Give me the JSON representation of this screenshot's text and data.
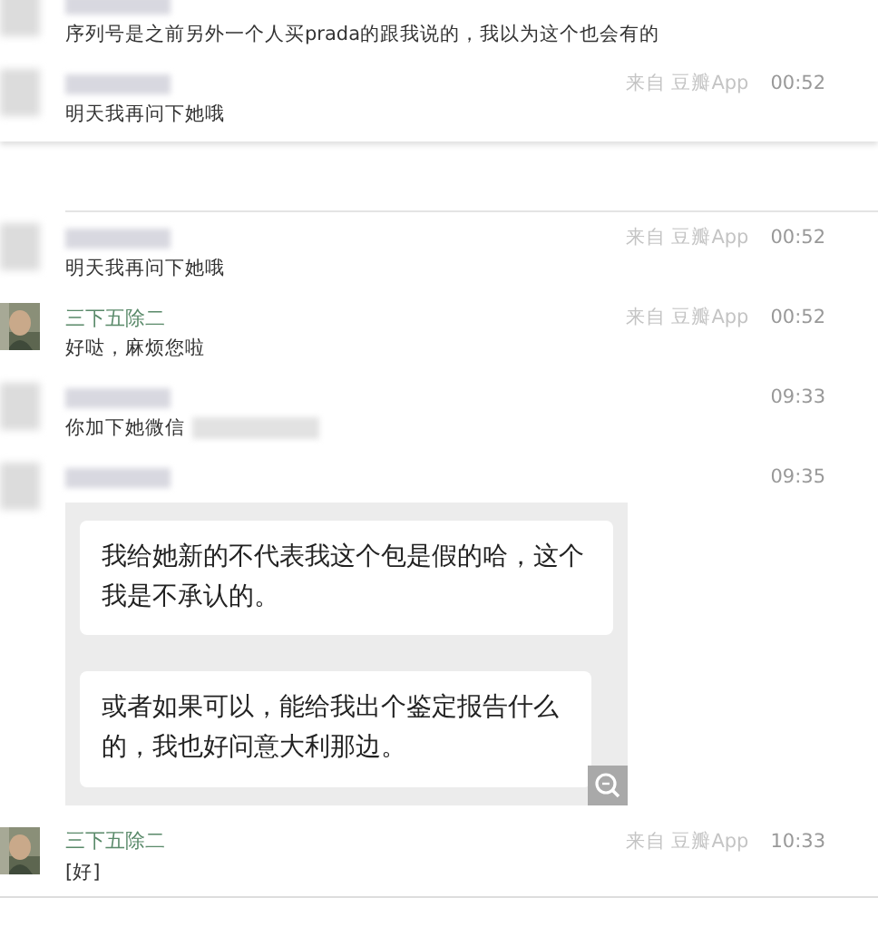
{
  "top_messages": [
    {
      "kind": "text",
      "author_hidden": true,
      "text": "序列号是之前另外一个人买prada的跟我说的，我以为这个也会有的",
      "trailing_blur": false
    },
    {
      "kind": "text",
      "author_hidden": true,
      "source": "来自 豆瓣App",
      "time": "00:52",
      "text": "明天我再问下她哦",
      "trailing_blur": false
    }
  ],
  "messages": [
    {
      "kind": "text",
      "author_hidden": true,
      "source": "来自 豆瓣App",
      "time": "00:52",
      "text": "明天我再问下她哦",
      "trailing_blur": false
    },
    {
      "kind": "text",
      "author_hidden": false,
      "author": "三下五除二",
      "source": "来自 豆瓣App",
      "time": "00:52",
      "text": "好哒，麻烦您啦",
      "trailing_blur": false
    },
    {
      "kind": "text",
      "author_hidden": true,
      "time": "09:33",
      "text": "你加下她微信",
      "trailing_blur": true
    },
    {
      "author_hidden": true,
      "time": "09:35",
      "bubbles": [
        "我给她新的不代表我这个包是假的哈，这个我是不承认的。",
        "或者如果可以，能给我出个鉴定报告什么的，我也好问意大利那边。"
      ]
    },
    {
      "kind": "text",
      "author_hidden": false,
      "author": "三下五除二",
      "source": "来自 豆瓣App",
      "time": "10:33",
      "text": "[好]",
      "trailing_blur": false
    }
  ]
}
